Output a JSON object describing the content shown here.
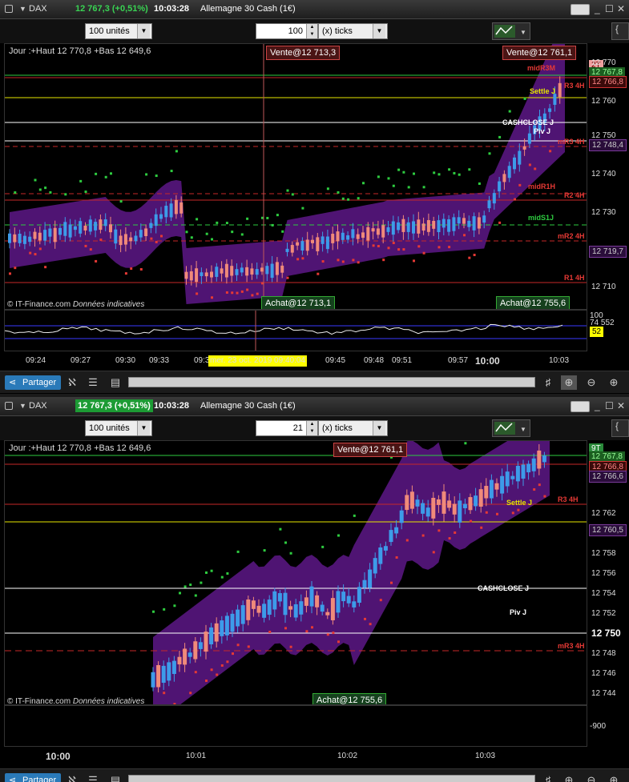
{
  "windows": [
    {
      "symbol": "DAX",
      "last_price": "12 767,3 (+0,51%)",
      "time": "10:03:28",
      "instrument": "Allemagne 30 Cash (1€)",
      "units": "100 unités",
      "ticks_value": "100",
      "ticks_label": "(x) ticks",
      "info": "Jour :+Haut 12 770,8 +Bas 12 649,6",
      "vente_orders": [
        "Vente@12 713,3",
        "Vente@12 761,1"
      ],
      "achat_orders": [
        "Achat@12 713,1",
        "Achat@12 755,6"
      ],
      "period_badge": "2T",
      "copyright": "© IT-Finance.com",
      "copyright_note": "Données indicatives",
      "y_ticks": [
        "12 770",
        "12 760",
        "12 750",
        "12 740",
        "12 730",
        "12 720",
        "12 710"
      ],
      "price_tags": [
        "12 767,8",
        "12 766,8",
        "12 748,4",
        "12 719,7"
      ],
      "line_labels": {
        "midR3M": "midR3M",
        "r3": "R3 4H",
        "settle": "Settle J",
        "cashclose": "CASHCLOSE J",
        "piv": "Piv J",
        "mr3": "mR3 4H",
        "midr1h": "midR1H",
        "r2": "R2 4H",
        "mids1j": "midS1J",
        "mr2": "mR2 4H",
        "r1": "R1 4H"
      },
      "osc_ticks": [
        "100",
        "74 552"
      ],
      "osc_value": "52",
      "x_ticks": [
        "09:24",
        "09:27",
        "09:30",
        "09:33",
        "09:3",
        "09:45",
        "09:48",
        "09:51",
        "09:57",
        "10:00",
        "10:03"
      ],
      "crosshair_time": "mer. 23 oct. 2019 09:40:04",
      "share_label": "Partager"
    },
    {
      "symbol": "DAX",
      "last_price": "12 767,3 (+0,51%)",
      "time": "10:03:28",
      "instrument": "Allemagne 30 Cash (1€)",
      "units": "100 unités",
      "ticks_value": "21",
      "ticks_label": "(x) ticks",
      "info": "Jour :+Haut 12 770,8 +Bas 12 649,6",
      "vente_orders": [
        "Vente@12 761,1"
      ],
      "achat_orders": [
        "Achat@12 755,6"
      ],
      "period_badge": "9T",
      "copyright": "© IT-Finance.com",
      "copyright_note": "Données indicatives",
      "y_ticks": [
        "12 762",
        "12 760",
        "12 758",
        "12 756",
        "12 754",
        "12 752",
        "12 750",
        "12 748",
        "12 746",
        "12 744"
      ],
      "price_tags": [
        "12 767,8",
        "12 766,8",
        "12 766,6",
        "12 760,5"
      ],
      "line_labels": {
        "r3": "R3 4H",
        "settle": "Settle J",
        "cashclose": "CASHCLOSE J",
        "piv": "Piv J",
        "mr3": "mR3 4H"
      },
      "osc_ticks": [
        "-900"
      ],
      "x_ticks": [
        "10:00",
        "10:01",
        "10:02",
        "10:03"
      ],
      "share_label": "Partager"
    }
  ],
  "colors": {
    "up": "#3d9be9",
    "down": "#f08a7a",
    "band": "#6a1b9a",
    "r_line": "#c62828",
    "settle": "#e6e600",
    "pivot": "#ffffff",
    "green_dot": "#2ecc40",
    "red_dot": "#e53935"
  }
}
